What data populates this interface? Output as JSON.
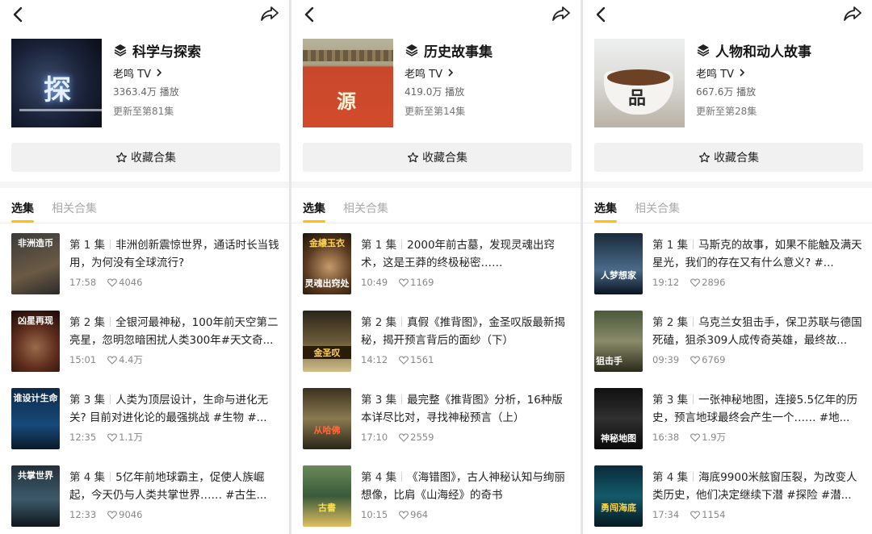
{
  "panels": [
    {
      "title": "科学与探索",
      "author": "老鸣 TV",
      "plays": "3363.4万 播放",
      "update": "更新至第81集",
      "cover_text": "探",
      "collect_label": "收藏合集",
      "tabs": [
        {
          "label": "选集"
        },
        {
          "label": "相关合集"
        }
      ],
      "episodes": [
        {
          "thumb_text": "非洲造币",
          "ep": "第 1 集",
          "title": "非洲创新震惊世界，通话时长当钱用，为何没有全球流行?",
          "duration": "17:58",
          "likes": "4046"
        },
        {
          "thumb_text": "凶星再现",
          "ep": "第 2 集",
          "title": "全银河最神秘，100年前天空第二亮星，忽明忽暗困扰人类300年#天文奇...",
          "duration": "15:01",
          "likes": "4.4万"
        },
        {
          "thumb_text": "谁设计生命",
          "ep": "第 3 集",
          "title": "人类为顶层设计，生命与进化无关? 目前对进化论的最强挑战 #生物 #...",
          "duration": "12:35",
          "likes": "1.1万"
        },
        {
          "thumb_text": "共掌世界",
          "ep": "第 4 集",
          "title": "5亿年前地球霸主，促使人族崛起，今天仍与人类共掌世界…… #古生...",
          "duration": "12:33",
          "likes": "9046"
        }
      ]
    },
    {
      "title": "历史故事集",
      "author": "老鸣 TV",
      "plays": "419.0万 播放",
      "update": "更新至第14集",
      "cover_text": "源",
      "collect_label": "收藏合集",
      "tabs": [
        {
          "label": "选集"
        },
        {
          "label": "相关合集"
        }
      ],
      "episodes": [
        {
          "thumb_text": "金縷玉衣",
          "thumb_text2": "灵魂出窍处",
          "ep": "第 1 集",
          "title": "2000年前古墓，发现灵魂出窍术，这是王莽的终极秘密……",
          "duration": "10:49",
          "likes": "1169"
        },
        {
          "thumb_text": "金圣叹",
          "ep": "第 2 集",
          "title": "真假《推背图》，金圣叹版最新揭秘，揭开预言背后的面纱（下）",
          "duration": "14:12",
          "likes": "1561"
        },
        {
          "thumb_text": "从哈佛",
          "ep": "第 3 集",
          "title": "最完整《推背图》分析，16种版本详尽比对，寻找神秘预言（上）",
          "duration": "17:10",
          "likes": "2559"
        },
        {
          "thumb_text": "古書",
          "ep": "第 4 集",
          "title": "《海错图》，古人神秘认知与绚丽想像，比肩《山海经》的奇书",
          "duration": "10:15",
          "likes": "964"
        }
      ]
    },
    {
      "title": "人物和动人故事",
      "author": "老鸣 TV",
      "plays": "667.6万 播放",
      "update": "更新至第28集",
      "cover_text": "品",
      "collect_label": "收藏合集",
      "tabs": [
        {
          "label": "选集"
        },
        {
          "label": "相关合集"
        }
      ],
      "episodes": [
        {
          "thumb_text": "人梦想家",
          "ep": "第 1 集",
          "title": "马斯克的故事，如果不能触及满天星光，我们的存在又有什么意义? #...",
          "duration": "19:12",
          "likes": "2896"
        },
        {
          "thumb_text": "狙击手",
          "ep": "第 2 集",
          "title": "乌克兰女狙击手，保卫苏联与德国死磕，狙杀309人成传奇英雄，最终故...",
          "duration": "09:39",
          "likes": "6769"
        },
        {
          "thumb_text": "神秘地图",
          "ep": "第 3 集",
          "title": "一张神秘地图，连接5.5亿年的历史，预言地球最终会产生一个…… #地...",
          "duration": "16:38",
          "likes": "1.9万"
        },
        {
          "thumb_text": "勇闯海底",
          "ep": "第 4 集",
          "title": "海底9900米舷窗压裂，为改变人类历史，他们决定继续下潜 #探险 #潜...",
          "duration": "17:34",
          "likes": "1154"
        }
      ]
    }
  ],
  "colors": {
    "accent": "#ffc107",
    "collect_bg": "#f1f1f1",
    "meta": "#888888"
  },
  "icons": {
    "back": "chevron-left-icon",
    "share": "share-arrow-icon",
    "collection": "stack-layers-icon",
    "star": "star-outline-icon",
    "heart": "heart-outline-icon"
  }
}
